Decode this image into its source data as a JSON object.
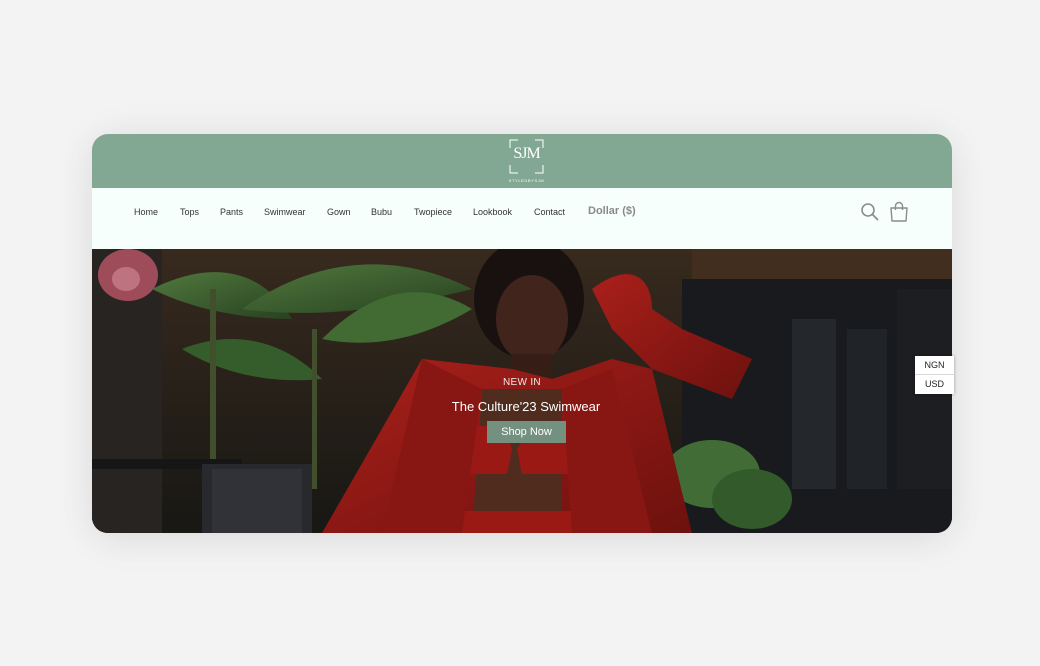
{
  "brand": {
    "logo_mark": "SJM",
    "logo_subtext": "STYLEDBYSJM"
  },
  "nav": {
    "items": [
      {
        "label": "Home"
      },
      {
        "label": "Tops"
      },
      {
        "label": "Pants"
      },
      {
        "label": "Swimwear"
      },
      {
        "label": "Gown"
      },
      {
        "label": "Bubu"
      },
      {
        "label": "Twopiece"
      },
      {
        "label": "Lookbook"
      },
      {
        "label": "Contact"
      }
    ],
    "currency_label": "Dollar ($)",
    "icons": [
      "search-icon",
      "shopping-bag-icon"
    ]
  },
  "hero": {
    "eyebrow": "NEW IN",
    "title": "The Culture'23 Swimwear",
    "cta_label": "Shop Now"
  },
  "currency_switch": {
    "options": [
      "NGN",
      "USD"
    ]
  },
  "colors": {
    "topbar": "#82a893",
    "nav_background": "#f6fffc",
    "cta": "#74907f",
    "page_background": "#f3f3f4"
  }
}
